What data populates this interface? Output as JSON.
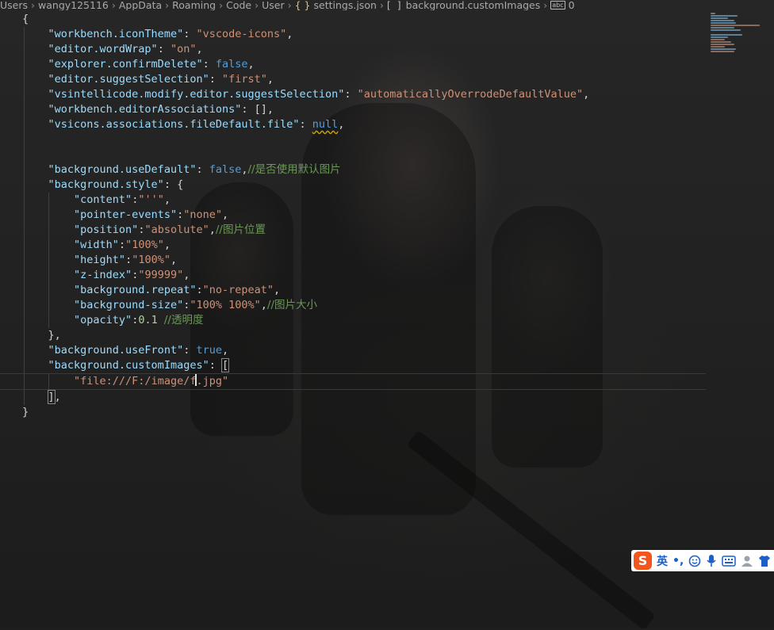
{
  "breadcrumb": {
    "items": [
      "Users",
      "wangy125116",
      "AppData",
      "Roaming",
      "Code",
      "User",
      "settings.json",
      "background.customImages",
      "0"
    ]
  },
  "code": {
    "lines": [
      "{",
      "\"workbench.iconTheme\": \"vscode-icons\",",
      "\"editor.wordWrap\": \"on\",",
      "\"explorer.confirmDelete\": false,",
      "\"editor.suggestSelection\": \"first\",",
      "\"vsintellicode.modify.editor.suggestSelection\": \"automaticallyOverrodeDefaultValue\",",
      "\"workbench.editorAssociations\": [],",
      "\"vsicons.associations.fileDefault.file\": null,",
      "",
      "",
      "\"background.useDefault\": false,//是否使用默认图片",
      "\"background.style\": {",
      "\"content\":\"''\",",
      "\"pointer-events\":\"none\",",
      "\"position\":\"absolute\",//图片位置",
      "\"width\":\"100%\",",
      "\"height\":\"100%\",",
      "\"z-index\":\"99999\",",
      "\"background.repeat\":\"no-repeat\",",
      "\"background-size\":\"100% 100%\",//图片大小",
      "\"opacity\":0.1 //透明度",
      "},",
      "\"background.useFront\": true,",
      "\"background.customImages\": [",
      "\"file:///F:/image/f.jpg\"",
      "],",
      "}"
    ]
  },
  "tokens": {
    "l1": {
      "k": "\"workbench.iconTheme\"",
      "v": "\"vscode-icons\""
    },
    "l2": {
      "k": "\"editor.wordWrap\"",
      "v": "\"on\""
    },
    "l3": {
      "k": "\"explorer.confirmDelete\"",
      "v": "false"
    },
    "l4": {
      "k": "\"editor.suggestSelection\"",
      "v": "\"first\""
    },
    "l5": {
      "k": "\"vsintellicode.modify.editor.suggestSelection\"",
      "v": "\"automaticallyOverrodeDefaultValue\""
    },
    "l6": {
      "k": "\"workbench.editorAssociations\"",
      "v": "[]"
    },
    "l7": {
      "k": "\"vsicons.associations.fileDefault.file\"",
      "v": "null"
    },
    "l10": {
      "k": "\"background.useDefault\"",
      "v": "false",
      "c": "//是否使用默认图片"
    },
    "l11": {
      "k": "\"background.style\"",
      "v": "{"
    },
    "l12": {
      "k": "\"content\"",
      "v": "\"''\""
    },
    "l13": {
      "k": "\"pointer-events\"",
      "v": "\"none\""
    },
    "l14": {
      "k": "\"position\"",
      "v": "\"absolute\"",
      "c": "//图片位置"
    },
    "l15": {
      "k": "\"width\"",
      "v": "\"100%\""
    },
    "l16": {
      "k": "\"height\"",
      "v": "\"100%\""
    },
    "l17": {
      "k": "\"z-index\"",
      "v": "\"99999\""
    },
    "l18": {
      "k": "\"background.repeat\"",
      "v": "\"no-repeat\""
    },
    "l19": {
      "k": "\"background-size\"",
      "v": "\"100% 100%\"",
      "c": "//图片大小"
    },
    "l20": {
      "k": "\"opacity\"",
      "v": "0.1",
      "c": "//透明度"
    },
    "l22": {
      "k": "\"background.useFront\"",
      "v": "true"
    },
    "l23": {
      "k": "\"background.customImages\"",
      "v": "["
    },
    "l24": {
      "v1": "\"file:///F:/image/f",
      "v2": ".jpg\""
    }
  },
  "colors": {
    "editor_bg": "#1e1e1e",
    "key": "#9cdcfe",
    "string": "#ce9178",
    "keyword": "#569cd6",
    "number": "#b5cea8",
    "comment": "#6a9955"
  },
  "ime": {
    "logo": "S",
    "lang": "英",
    "icons": [
      "punctuation-icon",
      "emoji-icon",
      "microphone-icon",
      "keyboard-icon",
      "user-icon",
      "shirt-icon"
    ]
  }
}
